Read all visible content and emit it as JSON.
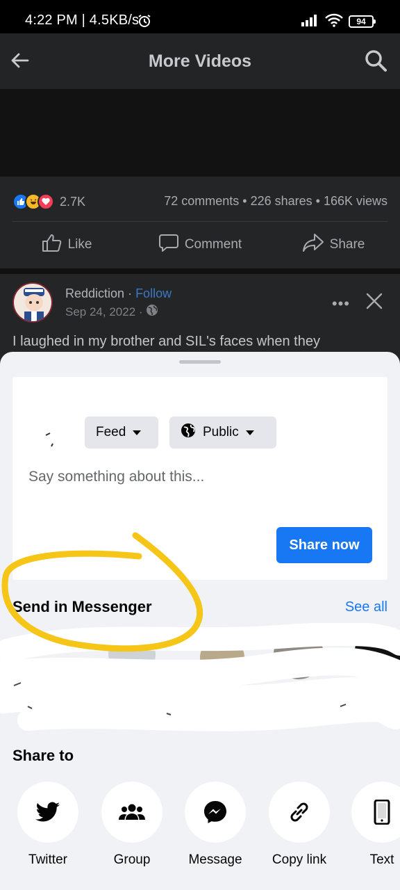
{
  "status_bar": {
    "time_speed": "4:22 PM | 4.5KB/s",
    "battery": "94"
  },
  "app_bar": {
    "title": "More Videos"
  },
  "post": {
    "reaction_count": "2.7K",
    "stats": "72 comments • 226 shares • 166K views",
    "actions": {
      "like": "Like",
      "comment": "Comment",
      "share": "Share"
    }
  },
  "post2": {
    "author": "Reddiction",
    "sep": " · ",
    "follow": "Follow",
    "date": "Sep 24, 2022 ·",
    "text": "I laughed in my brother and SIL's faces when they"
  },
  "composer": {
    "feed_pill": "Feed",
    "public_pill": "Public",
    "placeholder": "Say something about this...",
    "share_now": "Share now"
  },
  "messenger": {
    "title": "Send in Messenger",
    "see_all": "See all"
  },
  "share_to": {
    "title": "Share to",
    "items": [
      {
        "label": "Twitter",
        "icon": "twitter-icon"
      },
      {
        "label": "Group",
        "icon": "group-icon"
      },
      {
        "label": "Message",
        "icon": "messenger-icon"
      },
      {
        "label": "Copy link",
        "icon": "link-icon"
      },
      {
        "label": "Text",
        "icon": "phone-icon"
      }
    ]
  },
  "colors": {
    "accent": "#1877f2",
    "highlight": "#f5c518"
  }
}
